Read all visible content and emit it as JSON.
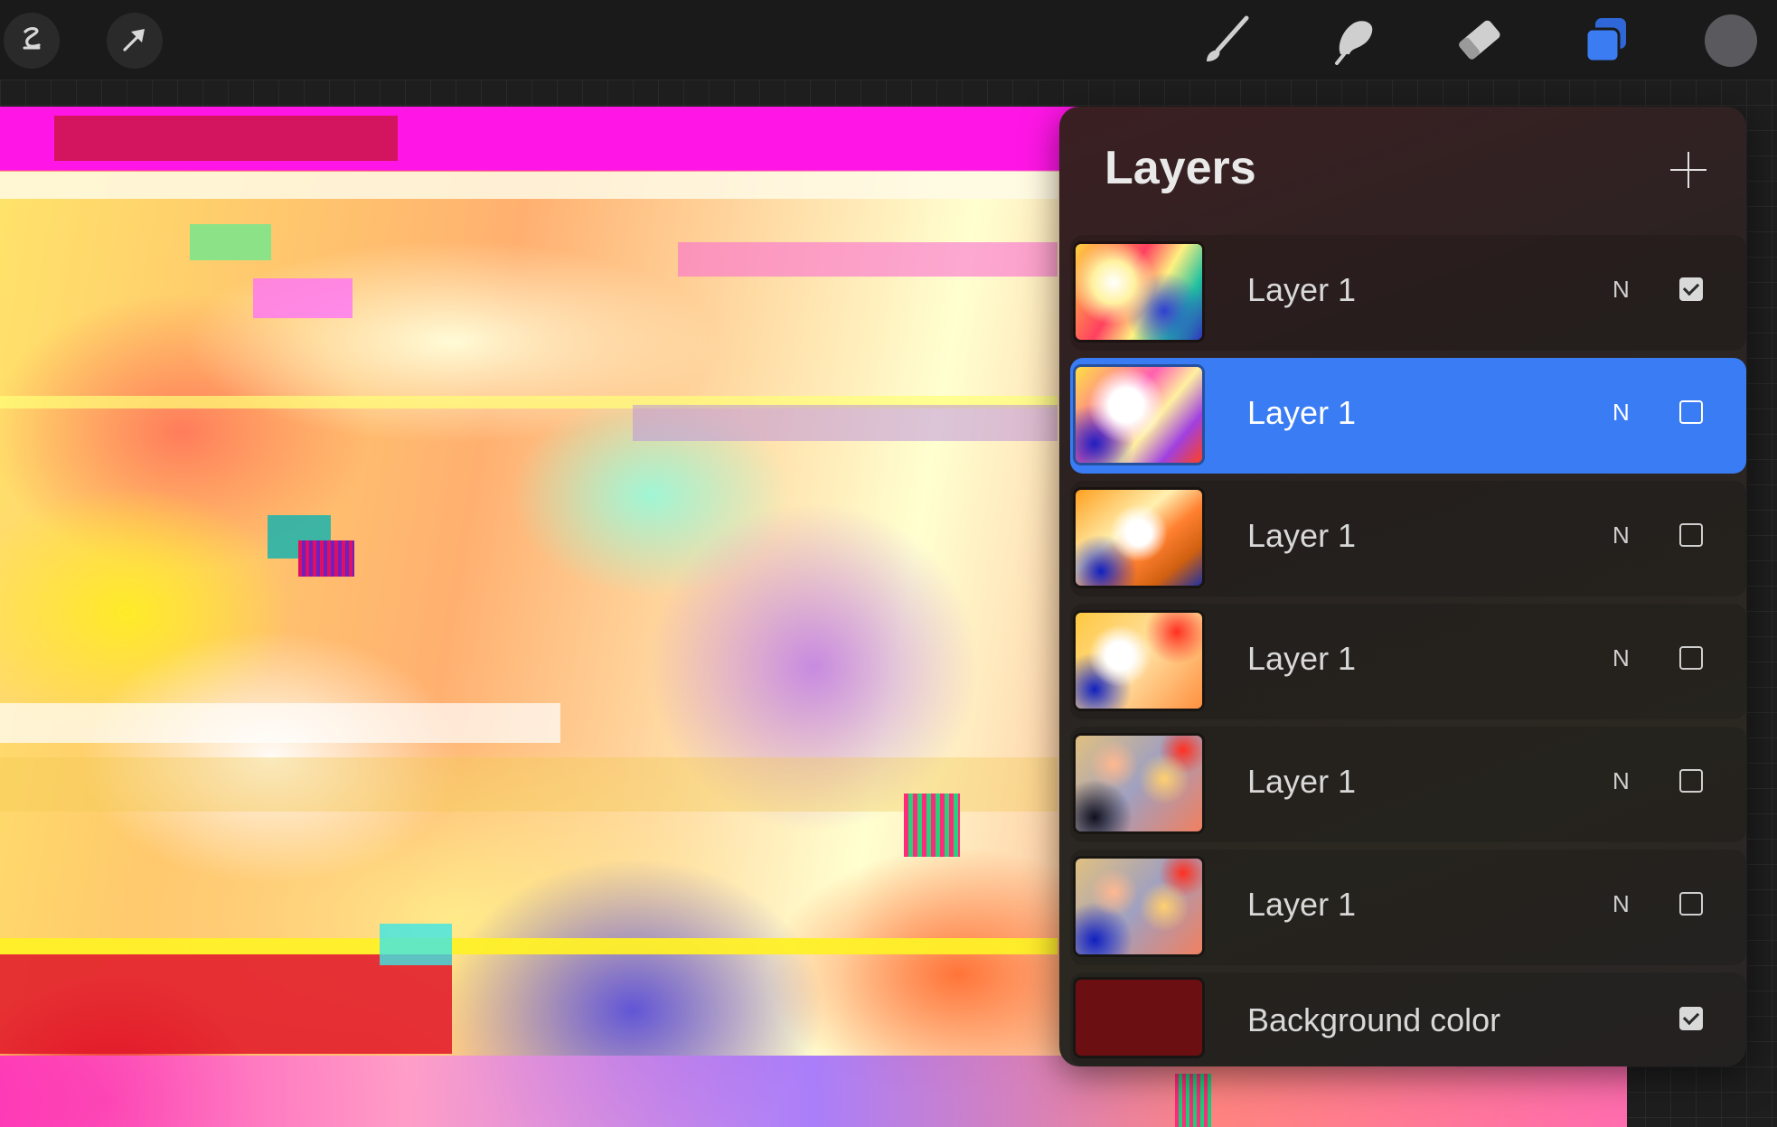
{
  "toolbar": {
    "left_icons": [
      "modify-icon",
      "selection-arrow-icon"
    ],
    "right_icons": [
      "brush-icon",
      "smudge-icon",
      "eraser-icon",
      "layers-icon",
      "color-swatch"
    ],
    "active_tool_color": "#3b7cf2",
    "color_swatch": "#5a5a5e"
  },
  "layers_panel": {
    "title": "Layers",
    "add_icon": "plus-icon",
    "layers": [
      {
        "name": "Layer 1",
        "mode": "N",
        "visible": true,
        "selected": false
      },
      {
        "name": "Layer 1",
        "mode": "N",
        "visible": false,
        "selected": true
      },
      {
        "name": "Layer 1",
        "mode": "N",
        "visible": false,
        "selected": false
      },
      {
        "name": "Layer 1",
        "mode": "N",
        "visible": false,
        "selected": false
      },
      {
        "name": "Layer 1",
        "mode": "N",
        "visible": false,
        "selected": false
      },
      {
        "name": "Layer 1",
        "mode": "N",
        "visible": false,
        "selected": false
      }
    ],
    "background": {
      "name": "Background color",
      "color": "#6b0f12",
      "visible": true
    }
  }
}
